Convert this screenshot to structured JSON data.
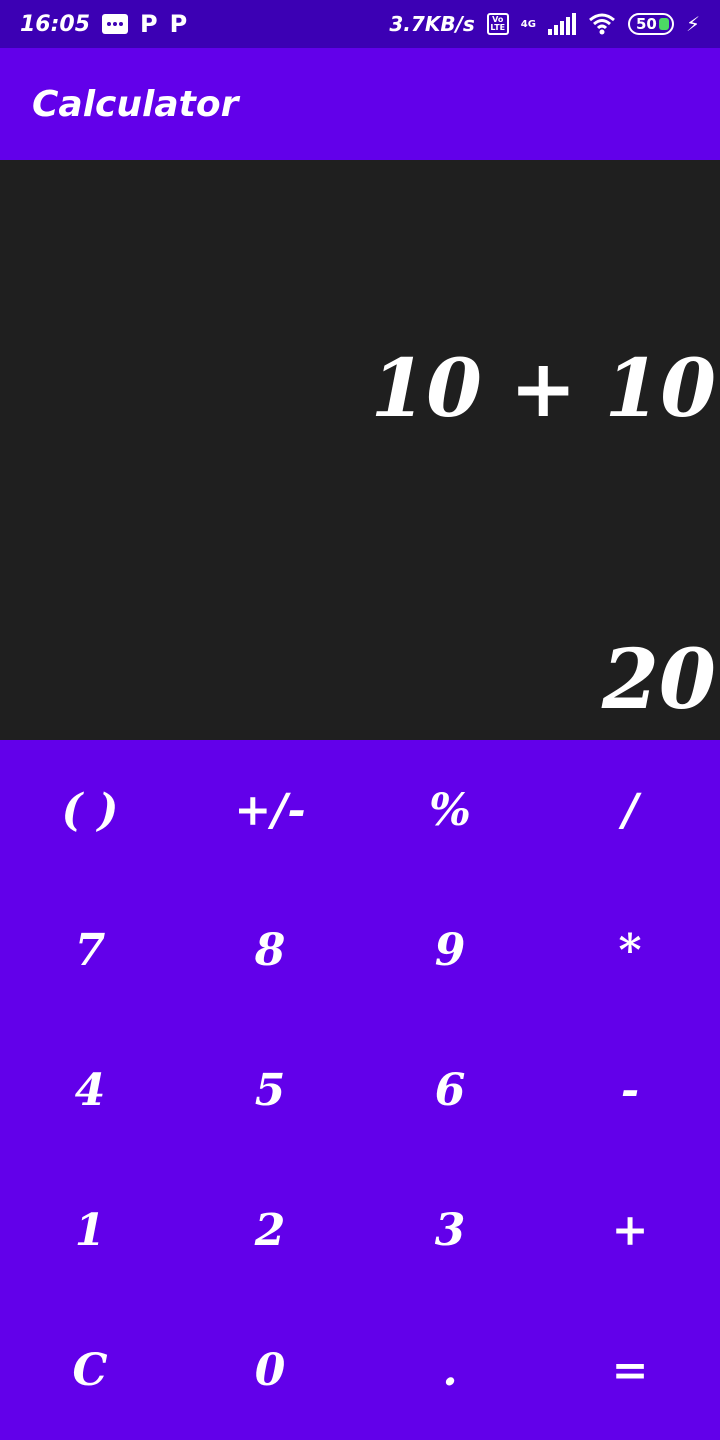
{
  "status_bar": {
    "time": "16:05",
    "notif_p1": "P",
    "notif_p2": "P",
    "speed": "3.7KB/s",
    "volte": "Vo LTE",
    "network": "4G",
    "battery": "50"
  },
  "app_bar": {
    "title": "Calculator"
  },
  "display": {
    "expression": "10 + 10",
    "result": "20"
  },
  "keypad": {
    "keys": [
      "( )",
      "+/-",
      "%",
      "/",
      "7",
      "8",
      "9",
      "*",
      "4",
      "5",
      "6",
      "-",
      "1",
      "2",
      "3",
      "+",
      "C",
      "0",
      ".",
      "="
    ]
  },
  "colors": {
    "status_bar": "#3c00b4",
    "primary": "#6200ea",
    "display_bg": "#1f1f1f",
    "text": "#ffffff"
  }
}
